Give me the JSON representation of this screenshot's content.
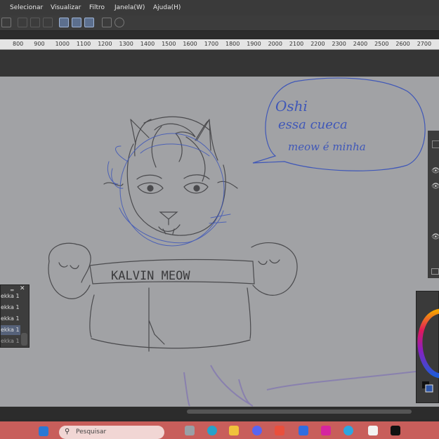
{
  "menu": {
    "items": [
      "Selecionar",
      "Visualizar",
      "Filtro",
      "Janela(W)",
      "Ajuda(H)"
    ]
  },
  "ruler": {
    "ticks": [
      "800",
      "900",
      "1000",
      "1100",
      "1200",
      "1300",
      "1400",
      "1500",
      "1600",
      "1700",
      "1800",
      "1900",
      "2000",
      "2100",
      "2200",
      "2300",
      "2400",
      "2500",
      "2600",
      "2700"
    ]
  },
  "canvas": {
    "speech_lines": [
      "Oshi",
      "essa cueca",
      "meow é minha"
    ],
    "banner_text": "KALVIN MEOW"
  },
  "layers": {
    "rows": [
      "ekka 1",
      "ekka 1",
      "ekka 1",
      "ekka 1",
      "ekka 1"
    ],
    "selected_index": 3
  },
  "taskbar": {
    "search_placeholder": "Pesquisar"
  },
  "colors": {
    "menubar": "#3a3a3a",
    "canvas": "#a1a2a5",
    "taskbar": "#c85e5b",
    "sketch_blue": "#3f57b8",
    "sketch_gray": "#4a4a4d",
    "selection": "#56627a"
  }
}
